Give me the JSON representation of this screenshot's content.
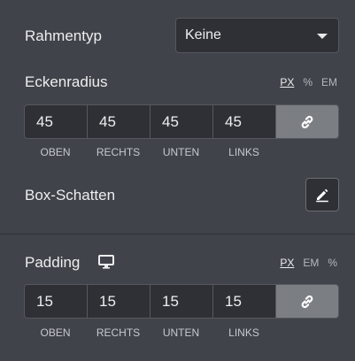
{
  "border": {
    "label": "Rahmentyp",
    "select_value": "Keine"
  },
  "radius": {
    "label": "Eckenradius",
    "units": [
      "PX",
      "%",
      "EM"
    ],
    "active_unit": "PX",
    "values": [
      "45",
      "45",
      "45",
      "45"
    ],
    "sides": [
      "OBEN",
      "RECHTS",
      "UNTEN",
      "LINKS"
    ]
  },
  "shadow": {
    "label": "Box-Schatten"
  },
  "padding": {
    "label": "Padding",
    "units": [
      "PX",
      "EM",
      "%"
    ],
    "active_unit": "PX",
    "values": [
      "15",
      "15",
      "15",
      "15"
    ],
    "sides": [
      "OBEN",
      "RECHTS",
      "UNTEN",
      "LINKS"
    ]
  },
  "icons": {
    "caret": "chevron-down-icon",
    "link": "link-icon",
    "edit": "pencil-icon",
    "device": "desktop-icon"
  },
  "colors": {
    "panel": "#404349",
    "input": "#2e3035",
    "link_button": "#7b7e83"
  }
}
